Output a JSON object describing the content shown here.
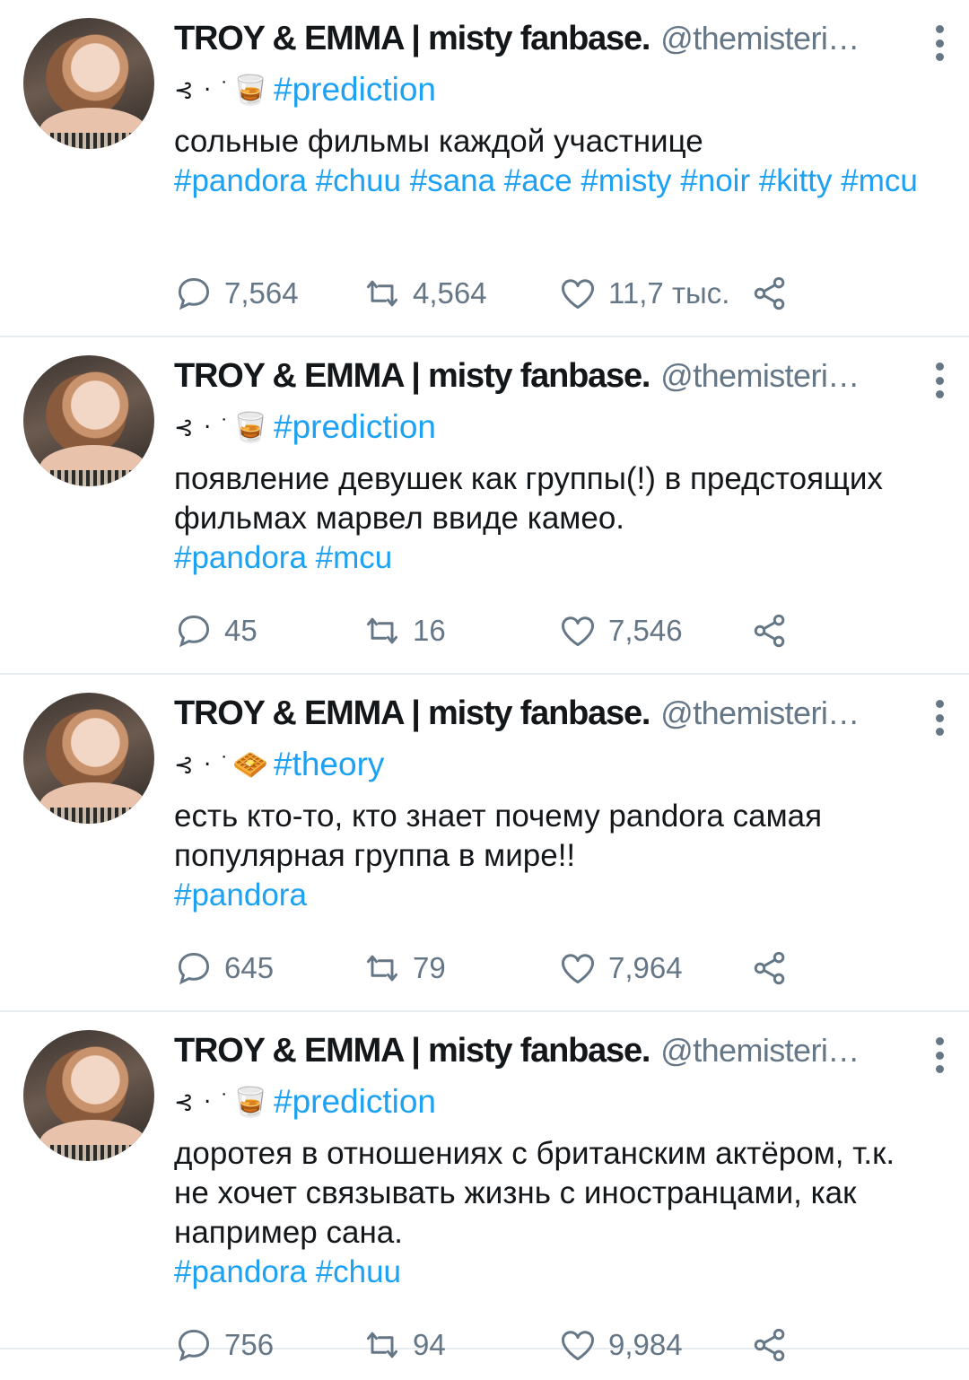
{
  "tweets": [
    {
      "name": "TROY & EMMA | misty fanbase.",
      "handle": "@themisteri…",
      "deco": "⊰ ‧ ˙",
      "emoji": "🥃",
      "category": "#prediction",
      "text": "сольные фильмы каждой участнице",
      "hashtags": "#pandora #chuu #sana #ace #misty #noir #kitty #mcu",
      "replies": "7,564",
      "retweets": "4,564",
      "likes": "11,7 тыс."
    },
    {
      "name": "TROY & EMMA | misty fanbase.",
      "handle": "@themisteri…",
      "deco": "⊰ ‧ ˙",
      "emoji": "🥃",
      "category": "#prediction",
      "text": "появление девушек как группы(!) в предстоящих фильмах марвел ввиде камео.",
      "hashtags": "#pandora #mcu",
      "replies": "45",
      "retweets": "16",
      "likes": "7,546"
    },
    {
      "name": "TROY & EMMA | misty fanbase.",
      "handle": "@themisteri…",
      "deco": "⊰ ‧ ˙",
      "emoji": "🧇",
      "category": "#theory",
      "text": "есть кто-то, кто знает почему pandora самая популярная группа в мире!!",
      "hashtags": "#pandora",
      "replies": "645",
      "retweets": "79",
      "likes": "7,964"
    },
    {
      "name": "TROY & EMMA | misty fanbase.",
      "handle": "@themisteri…",
      "deco": "⊰ ‧ ˙",
      "emoji": "🥃",
      "category": "#prediction",
      "text": "доротея в отношениях с британским актёром, т.к. не хочет связывать жизнь с иностранцами, как например сана.",
      "hashtags": "#pandora #chuu",
      "replies": "756",
      "retweets": "94",
      "likes": "9,984"
    }
  ],
  "icons": {
    "reply": "reply-icon",
    "retweet": "retweet-icon",
    "like": "heart-icon",
    "share": "share-icon",
    "more": "more-vertical-icon"
  },
  "colors": {
    "accent": "#1da1f2",
    "secondary": "#657786",
    "text": "#14171a",
    "divider": "#e6ecf0"
  }
}
